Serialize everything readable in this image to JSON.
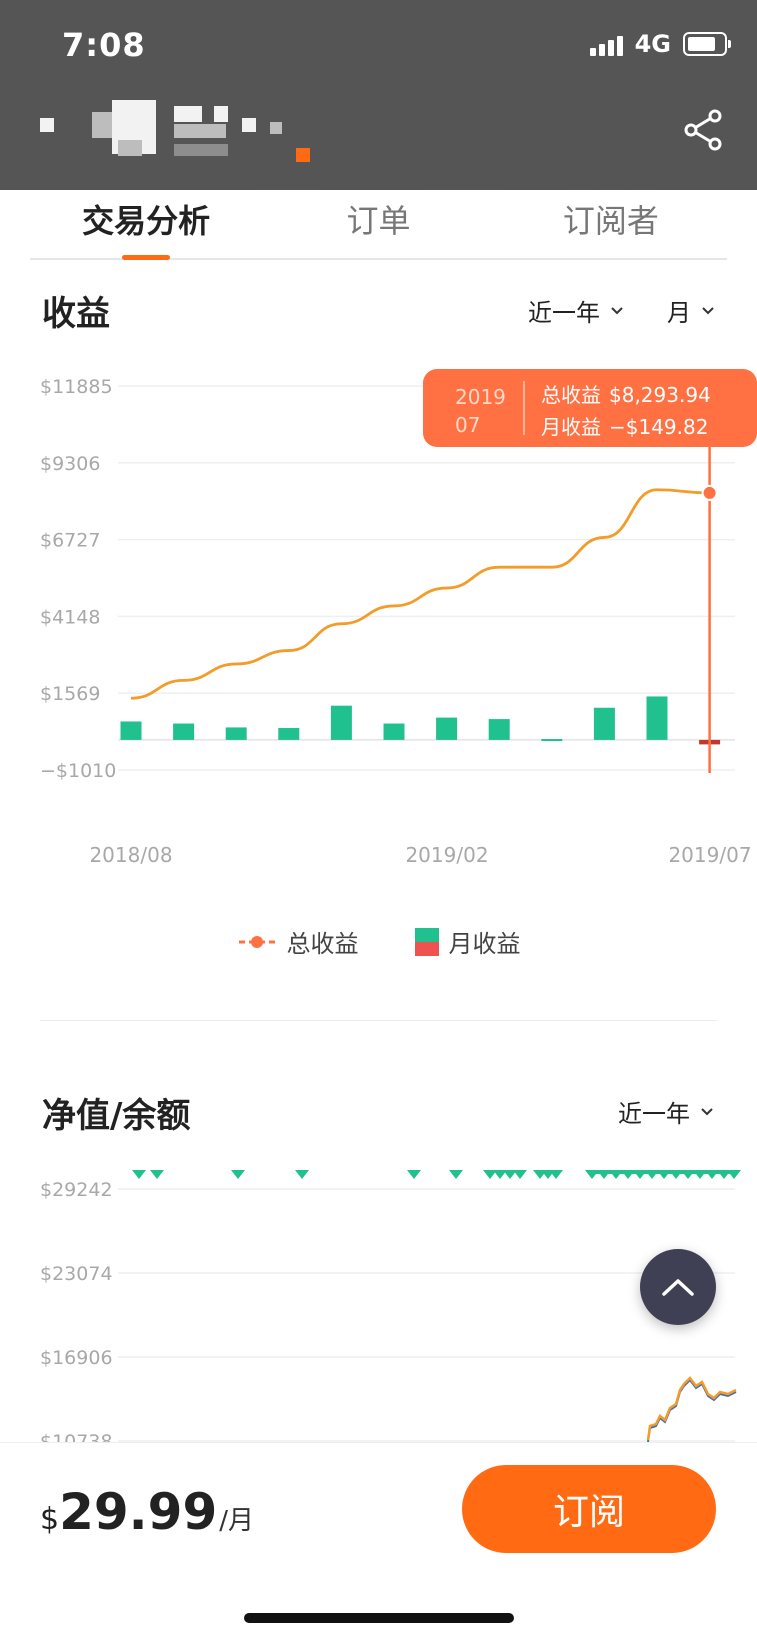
{
  "status_bar": {
    "time": "7:08",
    "network": "4G",
    "battery_level": 0.8
  },
  "tabs": [
    {
      "label": "交易分析",
      "active": true
    },
    {
      "label": "订单",
      "active": false
    },
    {
      "label": "订阅者",
      "active": false
    }
  ],
  "profit_section": {
    "title": "收益",
    "range_label": "近一年",
    "period_label": "月"
  },
  "tooltip": {
    "period_year": "2019",
    "period_month": "07",
    "total_label": "总收益",
    "total_value": "$8,293.94",
    "monthly_label": "月收益",
    "monthly_value": "−$149.82"
  },
  "legend": {
    "total": "总收益",
    "monthly": "月收益"
  },
  "chart_data": [
    {
      "type": "line",
      "y_ticks": [
        "$11885",
        "$9306",
        "$6727",
        "$4148",
        "$1569",
        "−$1010"
      ],
      "ylim": [
        -1010,
        11885
      ],
      "x_ticks": [
        "2018/08",
        "2019/02",
        "2019/07"
      ],
      "categories": [
        "2018/08",
        "2018/09",
        "2018/10",
        "2018/11",
        "2018/12",
        "2019/01",
        "2019/02",
        "2019/03",
        "2019/04",
        "2019/05",
        "2019/06",
        "2019/07"
      ],
      "series": [
        {
          "name": "总收益",
          "kind": "line",
          "color": "#f39c29",
          "values": [
            1400,
            2000,
            2550,
            3000,
            3900,
            4500,
            5100,
            5800,
            5800,
            6800,
            8400,
            8294
          ]
        },
        {
          "name": "月收益",
          "kind": "bar",
          "color": "#21c18f",
          "negative_color": "#c0392b",
          "values": [
            620,
            550,
            420,
            400,
            1150,
            550,
            750,
            700,
            30,
            1080,
            1460,
            -150
          ]
        }
      ],
      "highlight": "2019/07"
    },
    {
      "type": "line",
      "y_ticks": [
        "$29242",
        "$23074",
        "$16906",
        "$10738"
      ],
      "ylim": [
        10738,
        29242
      ],
      "series": [
        {
          "name": "净值",
          "color": "#f39c29"
        }
      ]
    }
  ],
  "networth_section": {
    "title": "净值/余额",
    "range_label": "近一年"
  },
  "bottom": {
    "currency": "$",
    "price": "29.99",
    "unit": "/月",
    "subscribe_label": "订阅"
  },
  "colors": {
    "accent": "#ff6a13",
    "header": "#555555",
    "bar": "#21c18f",
    "line": "#f39c29",
    "tooltip": "#ff7043"
  }
}
